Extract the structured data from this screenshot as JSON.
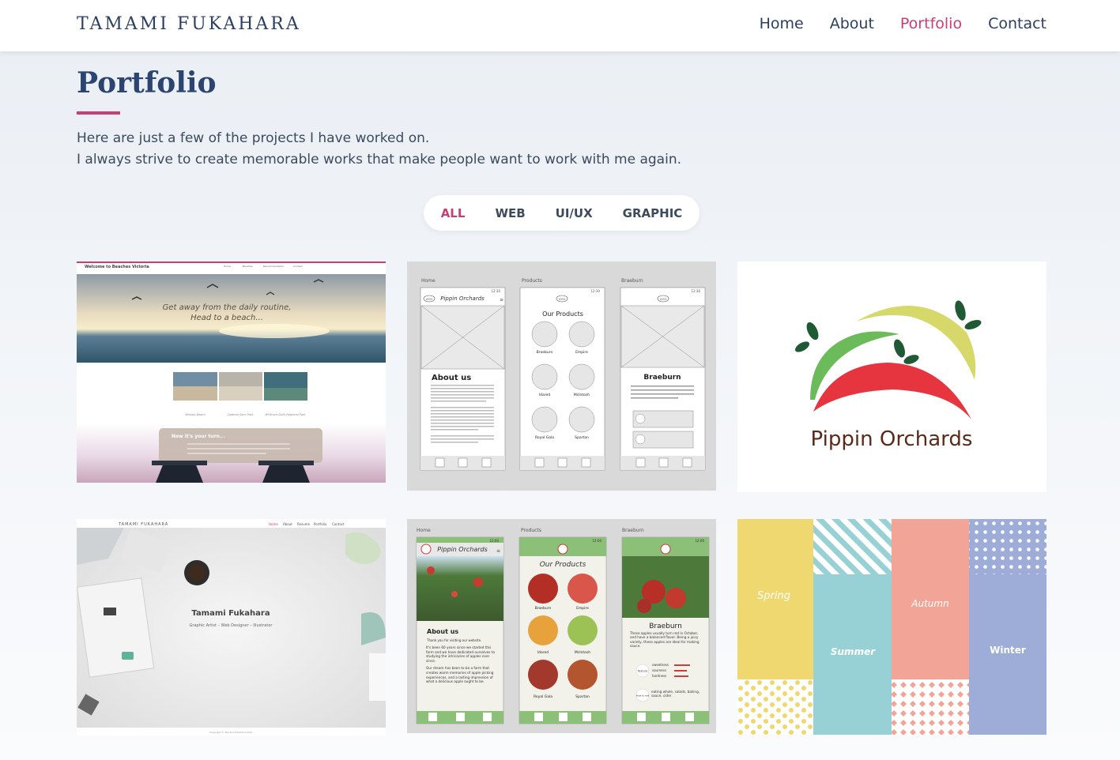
{
  "header": {
    "brand": "TAMAMI FUKAHARA",
    "nav": [
      {
        "label": "Home"
      },
      {
        "label": "About"
      },
      {
        "label": "Portfolio",
        "active": true
      },
      {
        "label": "Contact"
      }
    ]
  },
  "main": {
    "title": "Portfolio",
    "intro_line1": "Here are just a few of the projects I have worked on.",
    "intro_line2": "I always strive to create memorable works that make people want to work with me again.",
    "filters": [
      {
        "label": "ALL",
        "active": true
      },
      {
        "label": "WEB"
      },
      {
        "label": "UI/UX"
      },
      {
        "label": "GRAPHIC"
      }
    ]
  },
  "cards": {
    "beaches": {
      "site_title": "Welcome to Beaches Victoria",
      "nav": [
        "Home",
        "Beaches",
        "Recommendation",
        "Contact"
      ],
      "hero_line1": "Get away from the daily routine,",
      "hero_line2": "Head to a beach...",
      "thumb_labels": [
        "Willows Beach",
        "Cadboro Gyro Park",
        "Mt Bruce Gulfs Regional Park"
      ],
      "cta_title": "Now it's your turn..."
    },
    "wireframe": {
      "screens": [
        "Home",
        "Products",
        "Braeburn"
      ],
      "app_name": "Pippin Orchards",
      "logo": "LOGO",
      "about": "About us",
      "products_title": "Our Products",
      "products": [
        "Braeburn",
        "Empire",
        "Idared",
        "McIntosh",
        "Royal Gala",
        "Spartan"
      ],
      "detail_title": "Braeburn",
      "detail_text": "Lorem ipsum dolor sit amet, consectetur adipiscing elit. Fusce cursus ligula et scelerisque gravida. Duis",
      "time": "12:30"
    },
    "logo": {
      "name": "Pippin Orchards",
      "colors": {
        "red": "#e6353e",
        "green": "#6cbb5a",
        "yellow": "#d6d96a",
        "leaf": "#1f5a34",
        "text": "#5a2a1a"
      }
    },
    "personal": {
      "brand": "TAMAMI FUKAHARA",
      "nav": [
        "Home",
        "About",
        "Resume",
        "Portfolio",
        "Contact"
      ],
      "name": "Tamami Fukahara",
      "roles": "Graphic Artist – Web Designer – Illustrator",
      "footer": "Copyright © Tamami Fukahara 2020"
    },
    "mockup": {
      "screens": [
        "Home",
        "Products",
        "Braeburn"
      ],
      "app_name": "Pippin Orchards",
      "about": "About us",
      "about_text1": "Thank you for visiting our website.",
      "about_text2": "It's been 60 years since we started this farm and we have dedicated ourselves to studying the intricacies of apples ever since.",
      "about_text3": "Our dream has been to be a farm that creates warm memories of apple picking experiences, and a lasting impression of what a delicious apple ought to be.",
      "products_title": "Our Products",
      "products": [
        "Braeburn",
        "Empire",
        "Idared",
        "McIntosh",
        "Royal Gala",
        "Spartan"
      ],
      "detail_title": "Braeburn",
      "detail_text": "These apples usually turn red in October, and have a balanced flavor. Being a juicy variety, these apples are ideal for making sauce.",
      "texture": "Texture",
      "texture_items": [
        "sweetness",
        "sourness",
        "hardness"
      ],
      "how_to_eat": "How to eat",
      "how_to_eat_text": "eating whole, salads, baking, sauce, cider",
      "time": "12:00"
    },
    "seasons": {
      "labels": [
        "Spring",
        "Summer",
        "Autumn",
        "Winter"
      ],
      "colors": {
        "spring": "#eed86f",
        "summer": "#97d1d6",
        "autumn": "#f2a596",
        "winter": "#9eadd8"
      }
    }
  }
}
